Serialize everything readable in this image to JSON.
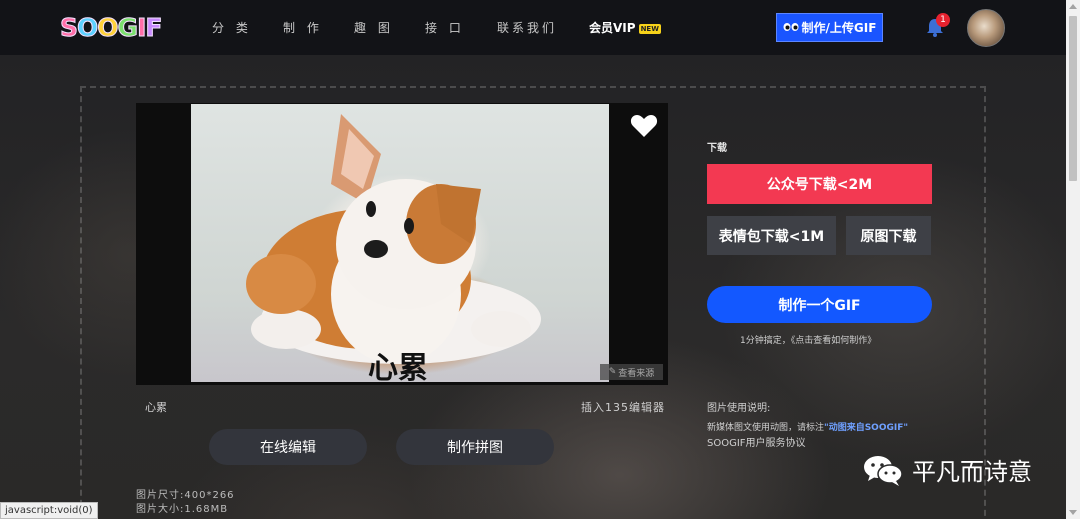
{
  "header": {
    "logo_text": "SOOGIF",
    "nav": [
      "分 类",
      "制 作",
      "趣 图",
      "接 口",
      "联系我们"
    ],
    "vip_label": "会员VIP",
    "vip_badge": "NEW",
    "upload_label": "制作/上传GIF",
    "notification_count": "1"
  },
  "viewer": {
    "gif_caption": "心累",
    "view_source": "查看来源",
    "image_title": "心累",
    "insert_editor": "插入135编辑器",
    "edit_online": "在线编辑",
    "make_collage": "制作拼图",
    "size_label": "图片尺寸:400*266",
    "filesize_label": "图片大小:1.68MB"
  },
  "download": {
    "label": "下载",
    "wechat_download": "公众号下载<2M",
    "sticker_download": "表情包下载<1M",
    "original_download": "原图下载",
    "make_gif": "制作一个GIF",
    "make_tip": "1分钟搞定，《点击查看如何制作》"
  },
  "usage": {
    "title": "图片使用说明:",
    "line1_prefix": "新媒体图文使用动图，请标注",
    "line1_link": "\"动图来自SOOGIF\"",
    "line2": "SOOGIF用户服务协议"
  },
  "watermark": {
    "name": "平凡而诗意"
  },
  "status_bar": "javascript:void(0)",
  "colors": {
    "header_bg": "#121317",
    "accent_blue": "#1358ff",
    "accent_red": "#f33952",
    "vip_badge": "#f6d21a"
  }
}
